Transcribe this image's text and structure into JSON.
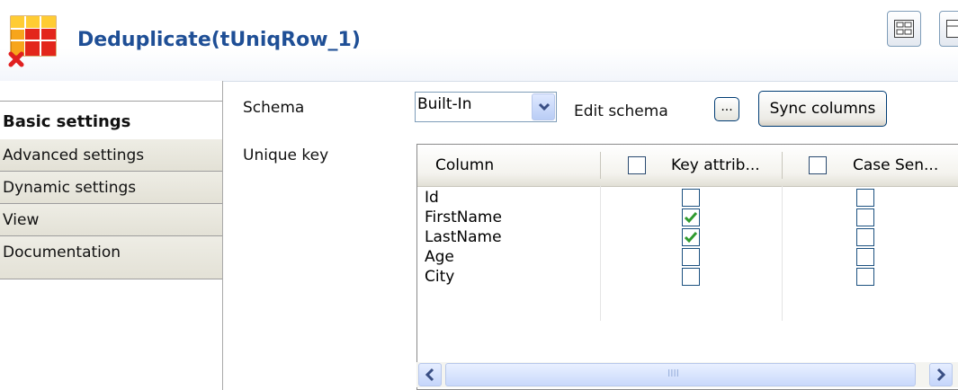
{
  "component": {
    "title": "Deduplicate(tUniqRow_1)",
    "icon": "tuniqrow-component-icon"
  },
  "tabs": [
    {
      "label": "Basic settings",
      "active": true
    },
    {
      "label": "Advanced settings",
      "active": false
    },
    {
      "label": "Dynamic settings",
      "active": false
    },
    {
      "label": "View",
      "active": false
    },
    {
      "label": "Documentation",
      "active": false
    }
  ],
  "schema": {
    "label": "Schema",
    "selected": "Built-In",
    "edit_label": "Edit schema",
    "edit_button": "...",
    "sync_button": "Sync columns"
  },
  "unique_key": {
    "label": "Unique key",
    "headers": {
      "column": "Column",
      "key": "Key attrib...",
      "case": "Case Sen..."
    },
    "rows": [
      {
        "column": "Id",
        "key": false,
        "case": false
      },
      {
        "column": "FirstName",
        "key": true,
        "case": false
      },
      {
        "column": "LastName",
        "key": true,
        "case": false
      },
      {
        "column": "Age",
        "key": false,
        "case": false
      },
      {
        "column": "City",
        "key": false,
        "case": false
      }
    ],
    "scroll_grip": "IIII"
  },
  "colors": {
    "title": "#1f4f96",
    "check": "#2f9a2f",
    "tab_bg": "#e7e5db"
  }
}
